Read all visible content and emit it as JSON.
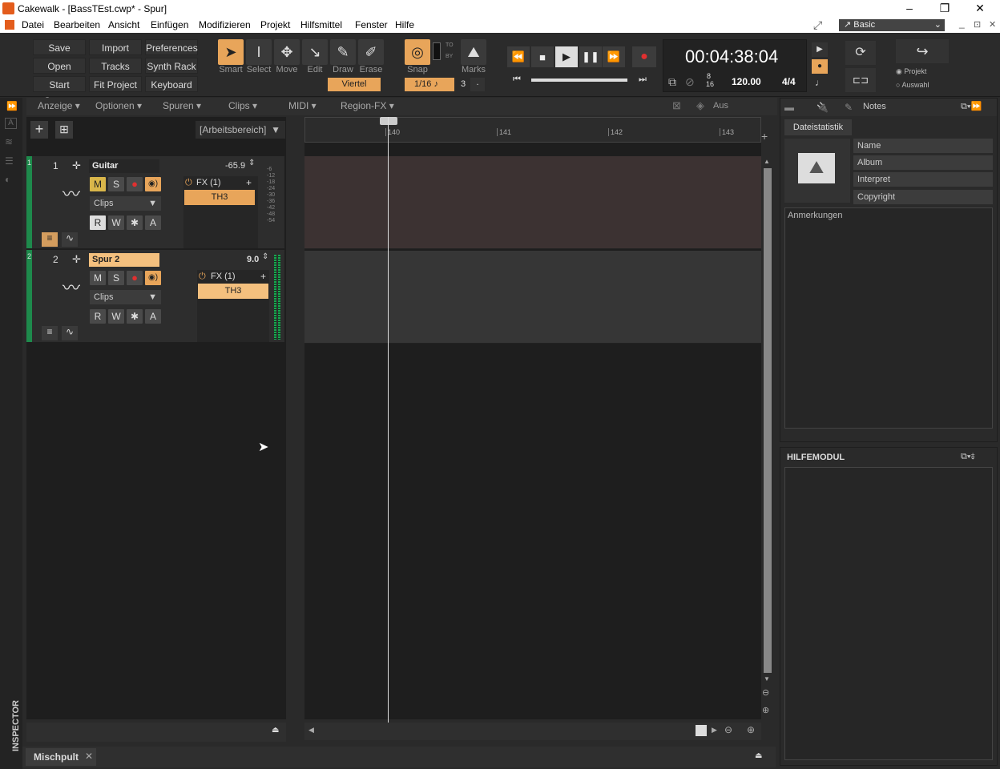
{
  "titlebar": {
    "title": "Cakewalk - [BassTEst.cwp* - Spur]",
    "minimize": "–",
    "restore": "❐",
    "close": "✕"
  },
  "menu": [
    "Datei",
    "Bearbeiten",
    "Ansicht",
    "Einfügen",
    "Modifizieren",
    "Projekt",
    "Hilfsmittel",
    "Fenster",
    "Hilfe"
  ],
  "workspace": {
    "label": "Basic",
    "mdi_min": "_",
    "mdi_restore": "⊡",
    "mdi_close": "✕"
  },
  "toolbar": {
    "buttons": [
      "Save",
      "Import",
      "Preferences",
      "Open",
      "Tracks",
      "Synth Rack",
      "Start Screen",
      "Fit Project",
      "Keyboard"
    ],
    "tools": [
      "Smart",
      "Select",
      "Move",
      "Edit",
      "Draw",
      "Erase"
    ],
    "tool_icons": [
      "smart-tool-icon",
      "select-tool-icon",
      "move-tool-icon",
      "edit-tool-icon",
      "draw-tool-icon",
      "erase-tool-icon"
    ],
    "draw_resolution": "Viertel",
    "snap_label": "Snap",
    "snap_to": "TO",
    "snap_by": "BY",
    "snap_value": "1/16",
    "snap_count": "3",
    "snap_dot": ".",
    "marks_label": "Marks",
    "time": "00:04:38:04",
    "meter_top": "8",
    "meter_bottom": "16",
    "tempo": "120.00",
    "signature": "4/4",
    "export_options": [
      "Projekt",
      "Auswahl"
    ]
  },
  "trackview_menu": [
    "Anzeige",
    "Optionen",
    "Spuren",
    "Clips",
    "MIDI",
    "Region-FX"
  ],
  "automation_mode": "Aus",
  "workspace_area": "[Arbeitsbereich]",
  "ruler": [
    "140",
    "141",
    "142",
    "143"
  ],
  "tracks": [
    {
      "number": "1",
      "color_idx": "1",
      "name": "Guitar",
      "volume": "-65.9",
      "fx": "FX (1)",
      "plugin": "TH3",
      "clips": "Clips",
      "buttons": {
        "m": "M",
        "s": "S",
        "r": "R",
        "w": "W",
        "star": "✱",
        "a": "A"
      },
      "meter": [
        "-6",
        "-12",
        "-18",
        "-24",
        "-30",
        "-36",
        "-42",
        "-48",
        "-54"
      ]
    },
    {
      "number": "2",
      "color_idx": "2",
      "name": "Spur 2",
      "volume": "9.0",
      "fx": "FX (1)",
      "plugin": "TH3",
      "clips": "Clips",
      "buttons": {
        "m": "M",
        "s": "S",
        "r": "R",
        "w": "W",
        "star": "✱",
        "a": "A"
      }
    }
  ],
  "browser": {
    "notes_tab": "Notes",
    "stats_tab": "Dateistatistik",
    "fields": [
      "Name",
      "Album",
      "Interpret",
      "Copyright"
    ],
    "remarks": "Anmerkungen"
  },
  "help_module": {
    "title": "HILFEMODUL"
  },
  "bottom": {
    "mixer_tab": "Mischpult",
    "close": "✕"
  },
  "inspector_label": "INSPECTOR",
  "colors": {
    "accent": "#e8a55a",
    "track_strip": "#1e8a4c",
    "record": "#e03030"
  }
}
